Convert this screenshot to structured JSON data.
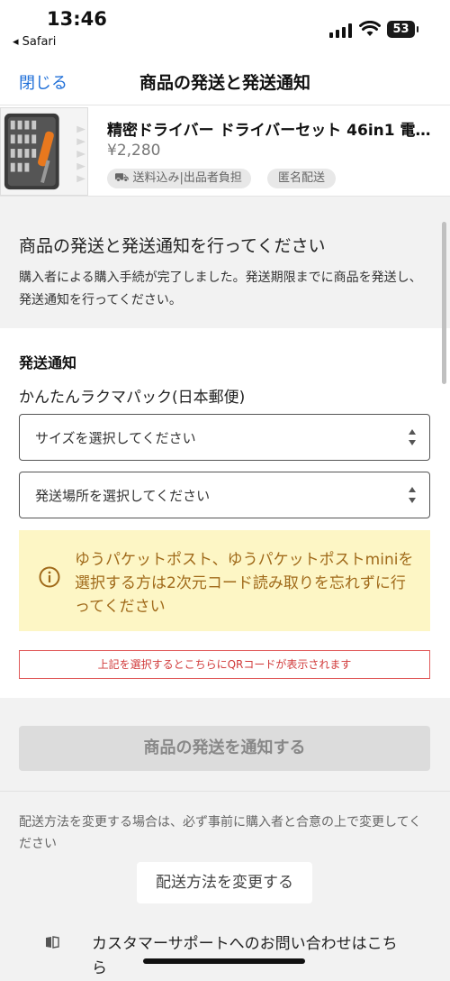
{
  "status_bar": {
    "time": "13:46",
    "back_app": "◂ Safari",
    "battery": "53"
  },
  "nav": {
    "close_label": "閉じる",
    "title": "商品の発送と発送通知"
  },
  "product": {
    "title": "精密ドライバー ドライバーセット 46in1 電…",
    "price": "¥2,280",
    "tags": [
      "⛟ 送料込み|出品者負担",
      "匿名配送"
    ]
  },
  "heading": {
    "title": "商品の発送と発送通知を行ってください",
    "description": "購入者による購入手続が完了しました。発送期限までに商品を発送し、発送通知を行ってください。"
  },
  "form": {
    "section_label": "発送通知",
    "method": "かんたんラクマパック(日本郵便)",
    "size_select": {
      "value": "サイズを選択してください"
    },
    "place_select": {
      "value": "発送場所を選択してください"
    },
    "notice": "ゆうパケットポスト、ゆうパケットポストminiを選択する方は2次元コード読み取りを忘れずに行ってください",
    "qr_hint": "上記を選択するとこちらにQRコードが表示されます"
  },
  "actions": {
    "submit_label": "商品の発送を通知する",
    "change_note": "配送方法を変更する場合は、必ず事前に購入者と合意の上で変更してください",
    "change_label": "配送方法を変更する",
    "support_label": "カスタマーサポートへのお問い合わせはこちら"
  },
  "colors": {
    "link": "#1f6fd8",
    "notice_bg": "#fdf6c5",
    "notice_text": "#a06a1a",
    "qr_hint": "#d13a3a"
  }
}
